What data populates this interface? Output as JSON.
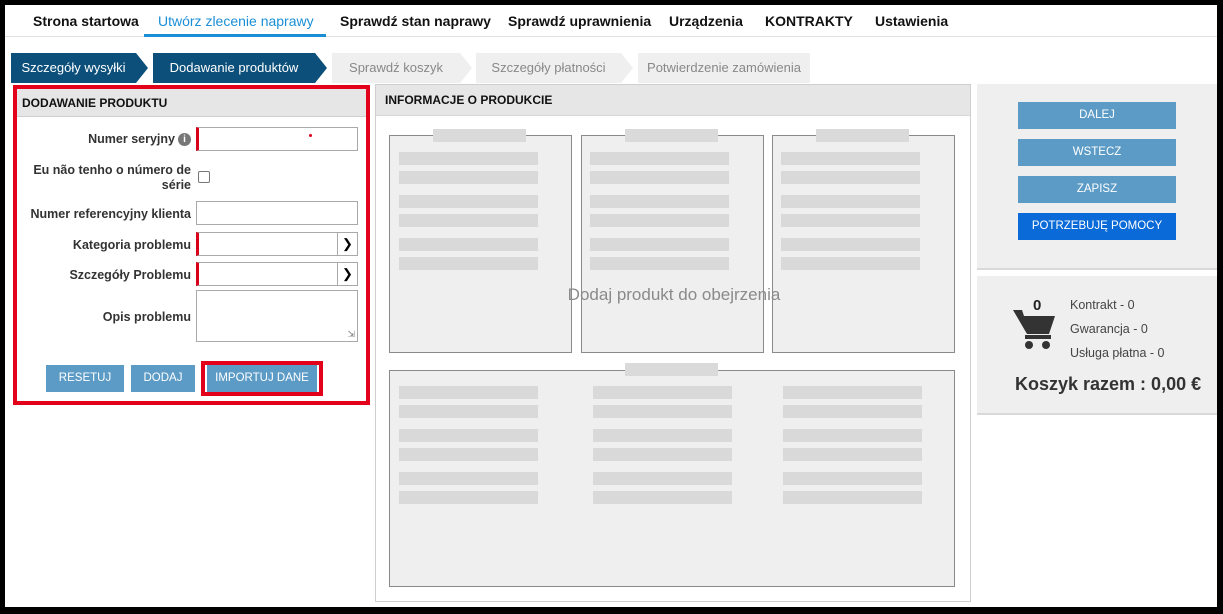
{
  "nav": {
    "items": [
      "Strona startowa",
      "Utwórz zlecenie naprawy",
      "Sprawdź stan naprawy",
      "Sprawdź uprawnienia",
      "Urządzenia",
      "KONTRAKTY",
      "Ustawienia"
    ],
    "active_index": 1
  },
  "steps": [
    {
      "label": "Szczegóły wysyłki",
      "state": "done"
    },
    {
      "label": "Dodawanie produktów",
      "state": "current"
    },
    {
      "label": "Sprawdź koszyk",
      "state": "todo"
    },
    {
      "label": "Szczegóły płatności",
      "state": "todo"
    },
    {
      "label": "Potwierdzenie zamówienia",
      "state": "todo"
    }
  ],
  "form": {
    "title": "DODAWANIE PRODUKTU",
    "serial_label": "Numer seryjny",
    "no_serial_label_1": "Eu não tenho o número de",
    "no_serial_label_2": "série",
    "customer_ref_label": "Numer referencyjny klienta",
    "category_label": "Kategoria problemu",
    "details_label": "Szczegóły Problemu",
    "description_label": "Opis problemu",
    "reset_button": "RESETUJ",
    "add_button": "DODAJ",
    "import_button": "IMPORTUJ DANE"
  },
  "product_info": {
    "title": "INFORMACJE O PRODUKCIE",
    "placeholder": "Dodaj produkt do obejrzenia"
  },
  "actions": {
    "next": "DALEJ",
    "back": "WSTECZ",
    "save": "ZAPISZ",
    "help": "POTRZEBUJĘ POMOCY"
  },
  "cart": {
    "count": "0",
    "contract": "Kontrakt - 0",
    "warranty": "Gwarancja - 0",
    "paid_service": "Usługa płatna - 0",
    "total": "Koszyk razem : 0,00 €"
  },
  "colors": {
    "accent": "#1a8fd6",
    "step_active": "#0b4f7a",
    "button": "#5b9bc6",
    "help_button": "#0a6ad8",
    "highlight": "#e3001b"
  }
}
